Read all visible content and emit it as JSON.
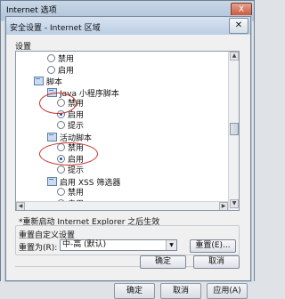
{
  "outer_window": {
    "title": "Internet 选项",
    "close_glyph": "X",
    "buttons": [
      "确定",
      "取消",
      "应用(A)"
    ]
  },
  "dialog": {
    "title": "安全设置 - Internet 区域",
    "close_glyph": "✕",
    "settings_label": "设置",
    "tree_rows": [
      {
        "kind": "radio",
        "label": "禁用",
        "selected": false,
        "indent": 1
      },
      {
        "kind": "radio",
        "label": "启用",
        "selected": false,
        "indent": 1
      },
      {
        "kind": "category",
        "label": "脚本",
        "indent": 0
      },
      {
        "kind": "category",
        "label": "Java 小程序脚本",
        "indent": 1
      },
      {
        "kind": "radio",
        "label": "禁用",
        "selected": false,
        "indent": 2
      },
      {
        "kind": "radio",
        "label": "启用",
        "selected": true,
        "indent": 2
      },
      {
        "kind": "radio",
        "label": "提示",
        "selected": false,
        "indent": 2
      },
      {
        "kind": "category",
        "label": "活动脚本",
        "indent": 1
      },
      {
        "kind": "radio",
        "label": "禁用",
        "selected": false,
        "indent": 2
      },
      {
        "kind": "radio",
        "label": "启用",
        "selected": true,
        "indent": 2
      },
      {
        "kind": "radio",
        "label": "提示",
        "selected": false,
        "indent": 2
      },
      {
        "kind": "category",
        "label": "启用 XSS 筛选器",
        "indent": 1
      },
      {
        "kind": "radio",
        "label": "禁用",
        "selected": false,
        "indent": 2
      },
      {
        "kind": "radio",
        "label": "启用",
        "selected": true,
        "indent": 2
      }
    ],
    "restart_note": "*重新启动 Internet Explorer 之后生效",
    "reset_group": {
      "title": "重置自定义设置",
      "reset_to_label": "重置为(R):",
      "selected_level": "中-高 (默认)",
      "reset_button": "重置(E)..."
    },
    "ok_button": "确定",
    "cancel_button": "取消"
  },
  "colors": {
    "annotation_red": "#c9302c",
    "title_gradient": "#bccfe4"
  }
}
